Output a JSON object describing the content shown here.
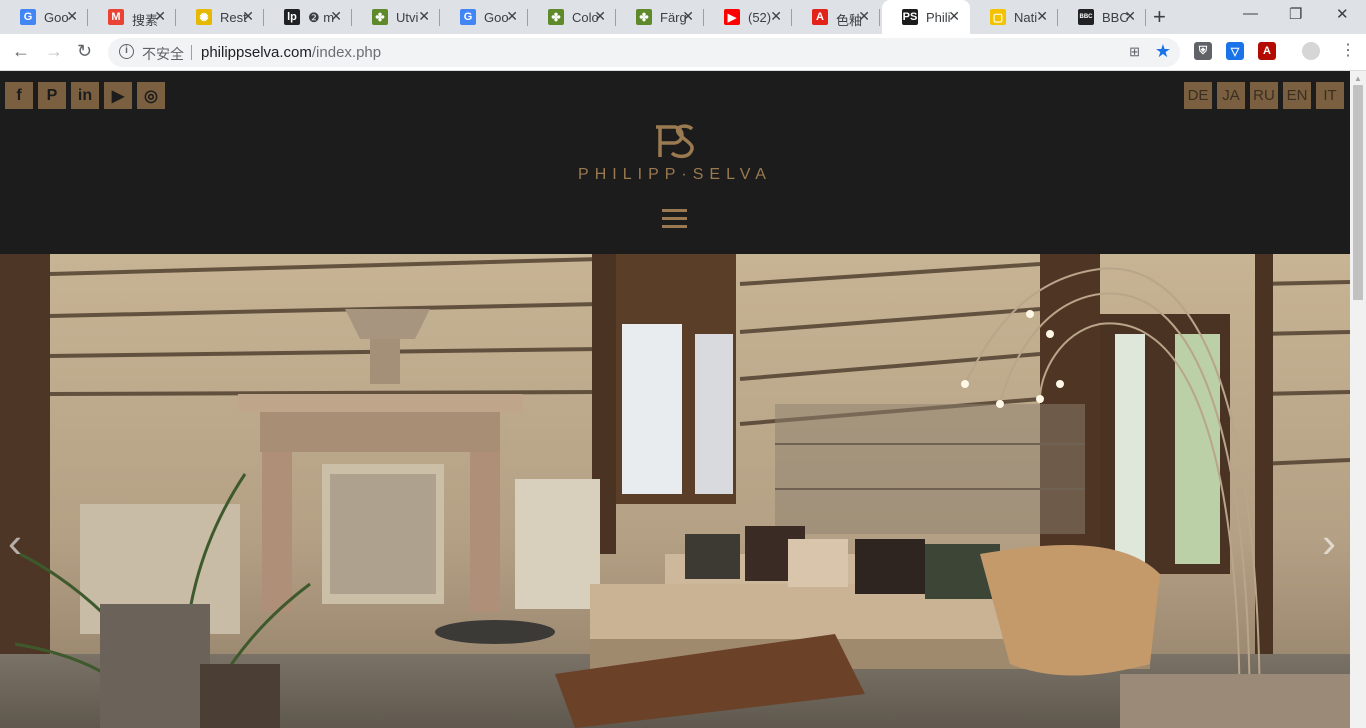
{
  "browser": {
    "tabs": [
      {
        "title": "Goo",
        "icon": "google-icon",
        "color": "#4285f4",
        "glyph": "G"
      },
      {
        "title": "搜素",
        "icon": "gmail-icon",
        "color": "#ea4335",
        "glyph": "M"
      },
      {
        "title": "Rest",
        "icon": "sun-icon",
        "color": "#e6b800",
        "glyph": "✺"
      },
      {
        "title": "❷ m",
        "icon": "app-icon",
        "color": "#202124",
        "glyph": "lp"
      },
      {
        "title": "Utvi",
        "icon": "leaf-icon",
        "color": "#5f8a2b",
        "glyph": "✤"
      },
      {
        "title": "Goo",
        "icon": "translate-icon",
        "color": "#4285f4",
        "glyph": "G"
      },
      {
        "title": "Colo",
        "icon": "leaf-icon",
        "color": "#5f8a2b",
        "glyph": "✤"
      },
      {
        "title": "Färg",
        "icon": "leaf-icon",
        "color": "#5f8a2b",
        "glyph": "✤"
      },
      {
        "title": "(52)",
        "icon": "youtube-icon",
        "color": "#ff0000",
        "glyph": "▶"
      },
      {
        "title": "色釉",
        "icon": "adobe-icon",
        "color": "#e2231a",
        "glyph": "A"
      },
      {
        "title": "Phili",
        "icon": "ps-logo-icon",
        "color": "#1c1c1c",
        "glyph": "PS",
        "active": true
      },
      {
        "title": "Nati",
        "icon": "natgeo-icon",
        "color": "#f4c300",
        "glyph": "▢"
      },
      {
        "title": "BBC",
        "icon": "bbc-icon",
        "color": "#202124",
        "glyph": "BBC"
      }
    ],
    "insecure_label": "不安全",
    "url_host": "philippselva.com",
    "url_path": "/index.php"
  },
  "site": {
    "social": [
      {
        "name": "facebook",
        "glyph": "f"
      },
      {
        "name": "pinterest",
        "glyph": "P"
      },
      {
        "name": "linkedin",
        "glyph": "in"
      },
      {
        "name": "youtube",
        "glyph": "▶"
      },
      {
        "name": "instagram",
        "glyph": "◎"
      }
    ],
    "languages": [
      "DE",
      "JA",
      "RU",
      "EN",
      "IT"
    ],
    "logo_text": "PHILIPP·SELVA",
    "accent_color": "#7a6040",
    "hero": {
      "prev": "‹",
      "next": "›"
    }
  }
}
